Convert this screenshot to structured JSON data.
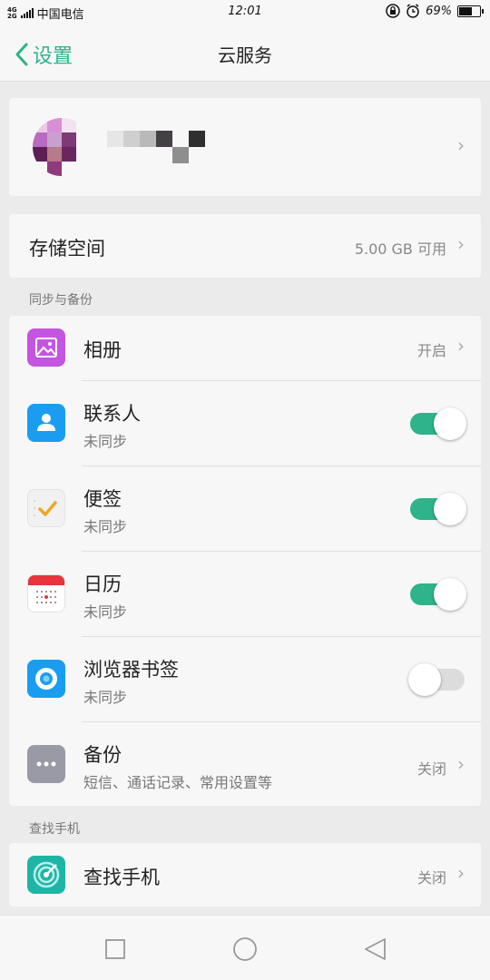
{
  "status_bar": {
    "network": "4G",
    "network2": "2G",
    "carrier": "中国电信",
    "time": "12:01",
    "battery": "69%",
    "battery_level": 0.69
  },
  "header": {
    "back_label": "设置",
    "title": "云服务"
  },
  "storage": {
    "label": "存储空间",
    "value": "5.00 GB 可用"
  },
  "sections": {
    "sync": "同步与备份",
    "find": "查找手机"
  },
  "sync_items": [
    {
      "title": "相册",
      "value": "开启",
      "icon": "gallery-icon"
    },
    {
      "title": "联系人",
      "subtitle": "未同步",
      "toggle": true,
      "icon": "contacts-icon"
    },
    {
      "title": "便签",
      "subtitle": "未同步",
      "toggle": true,
      "icon": "notes-icon"
    },
    {
      "title": "日历",
      "subtitle": "未同步",
      "toggle": true,
      "icon": "calendar-icon"
    },
    {
      "title": "浏览器书签",
      "subtitle": "未同步",
      "toggle": false,
      "icon": "browser-icon"
    },
    {
      "title": "备份",
      "subtitle": "短信、通话记录、常用设置等",
      "value": "关闭",
      "icon": "backup-icon"
    }
  ],
  "find_phone": {
    "title": "查找手机",
    "value": "关闭",
    "icon": "radar-icon"
  },
  "colors": {
    "accent": "#2eb38a",
    "gallery": "#c455e0",
    "contacts": "#1a9df0",
    "browser": "#1a9df0",
    "backup": "#9a9aa6",
    "radar": "#1fb5a6"
  }
}
